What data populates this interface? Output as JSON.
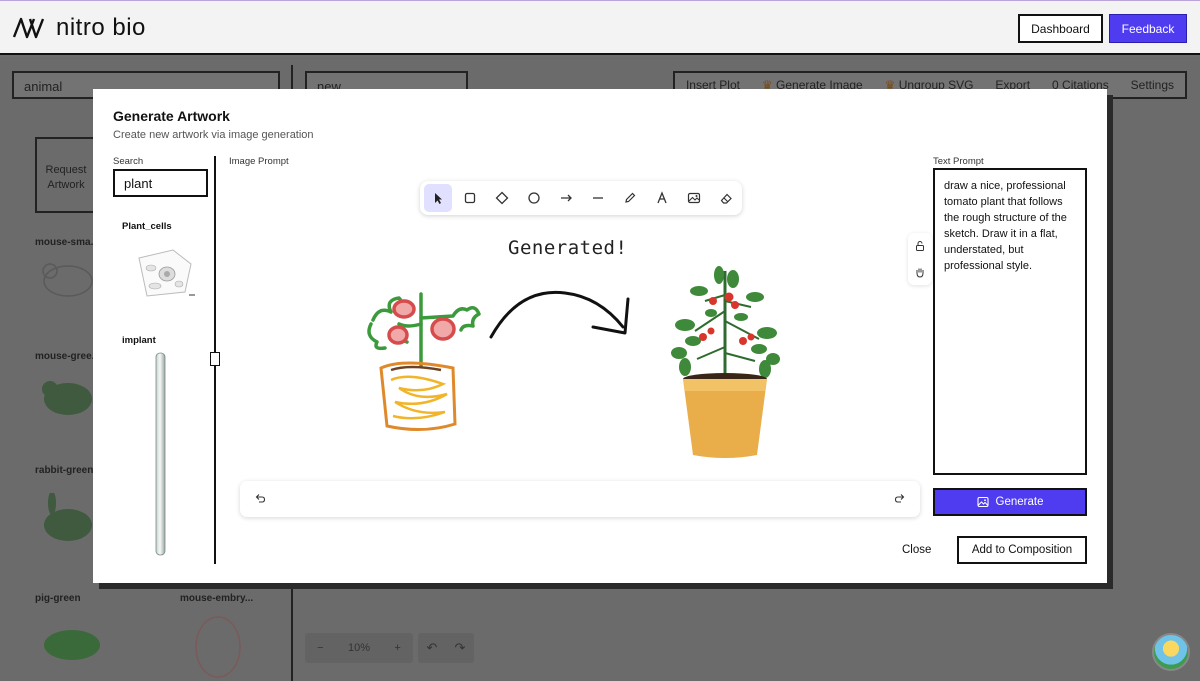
{
  "app": {
    "name": "nitro bio"
  },
  "topbar": {
    "dashboard_label": "Dashboard",
    "feedback_label": "Feedback"
  },
  "background": {
    "search_value": "animal",
    "canvas_name": "new",
    "tabs": [
      "Insert Plot",
      "Generate Image",
      "Ungroup SVG",
      "Export",
      "0 Citations",
      "Settings"
    ],
    "request_label": "Request Artwork",
    "library_items": [
      "mouse-sma...",
      "mouse-gree...",
      "rabbit-green",
      "pig-green",
      "mouse-embry..."
    ],
    "zoom": {
      "minus": "−",
      "value": "10%",
      "plus": "+"
    }
  },
  "modal": {
    "title": "Generate Artwork",
    "subtitle": "Create new artwork via image generation",
    "search_label": "Search",
    "search_value": "plant",
    "results": [
      "Plant_cells",
      "implant"
    ],
    "image_prompt_label": "Image Prompt",
    "canvas_annotation": "Generated!",
    "tools": [
      "cursor-icon",
      "rectangle-icon",
      "diamond-icon",
      "circle-icon",
      "arrow-icon",
      "line-icon",
      "pencil-icon",
      "text-icon",
      "image-icon",
      "eraser-icon"
    ],
    "text_prompt_label": "Text Prompt",
    "text_prompt_value": "draw a nice, professional tomato plant that follows the rough structure of the sketch. Draw it in a flat, understated, but professional style.",
    "generate_label": "Generate",
    "close_label": "Close",
    "add_label": "Add to Composition"
  },
  "colors": {
    "accent": "#4f3cf0",
    "overlay": "#6b6b6b"
  }
}
